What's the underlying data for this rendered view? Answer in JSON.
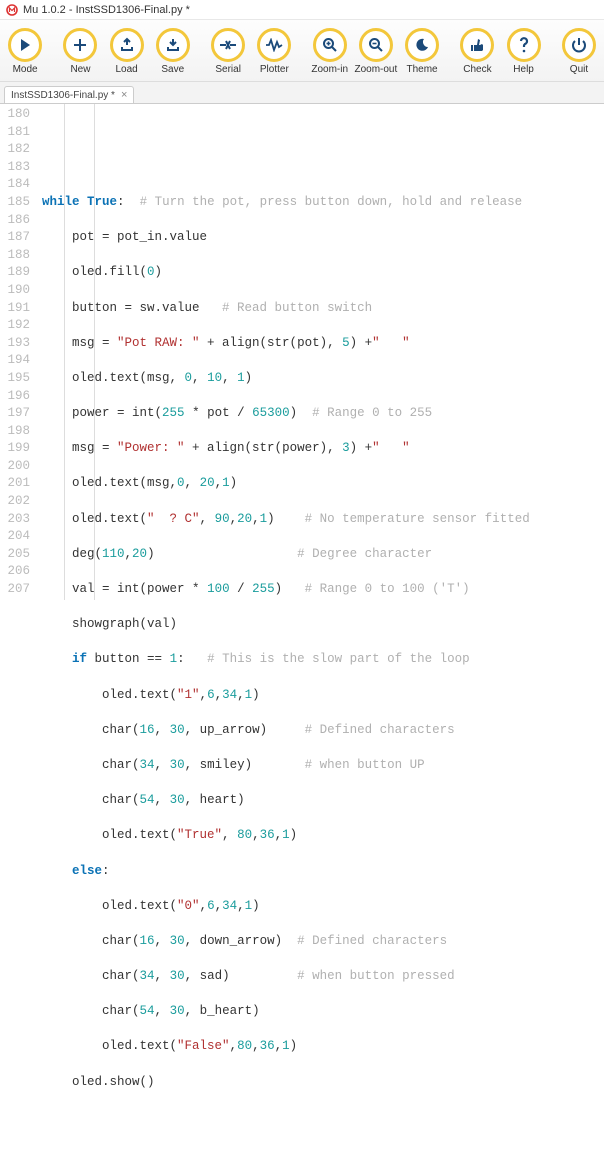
{
  "window": {
    "title": "Mu 1.0.2 - InstSSD1306-Final.py *"
  },
  "toolbar": {
    "mode": "Mode",
    "new": "New",
    "load": "Load",
    "save": "Save",
    "serial": "Serial",
    "plotter": "Plotter",
    "zoom_in": "Zoom-in",
    "zoom_out": "Zoom-out",
    "theme": "Theme",
    "check": "Check",
    "help": "Help",
    "quit": "Quit"
  },
  "tab": {
    "label": "InstSSD1306-Final.py *"
  },
  "line_start": 180,
  "line_end": 207,
  "code": {
    "l180": "",
    "l181_kw": "while",
    "l181_tr": "True",
    "l181_co": ":",
    "l181_cm": "  # Turn the pot, press button down, hold and release",
    "l182_a": "    pot ",
    "l182_op": "=",
    "l182_b": " pot_in.value",
    "l183_a": "    oled.fill(",
    "l183_n": "0",
    "l183_b": ")",
    "l184_a": "    button ",
    "l184_op": "=",
    "l184_b": " sw.value   ",
    "l184_cm": "# Read button switch",
    "l185_a": "    msg ",
    "l185_op": "=",
    "l185_s1": " \"Pot RAW: \"",
    "l185_b": " + align(str(pot), ",
    "l185_n": "5",
    "l185_c": ") +",
    "l185_s2": "\"   \"",
    "l186_a": "    oled.text(msg, ",
    "l186_n1": "0",
    "l186_b": ", ",
    "l186_n2": "10",
    "l186_c": ", ",
    "l186_n3": "1",
    "l186_d": ")",
    "l187_a": "    power ",
    "l187_op": "=",
    "l187_b": " int(",
    "l187_n1": "255",
    "l187_c": " * pot / ",
    "l187_n2": "65300",
    "l187_d": ")  ",
    "l187_cm": "# Range 0 to 255",
    "l188_a": "    msg ",
    "l188_op": "=",
    "l188_s1": " \"Power: \"",
    "l188_b": " + align(str(power), ",
    "l188_n": "3",
    "l188_c": ") +",
    "l188_s2": "\"   \"",
    "l189_a": "    oled.text(msg,",
    "l189_n1": "0",
    "l189_b": ", ",
    "l189_n2": "20",
    "l189_c": ",",
    "l189_n3": "1",
    "l189_d": ")",
    "l190_a": "    oled.text(",
    "l190_s": "\"  ? C\"",
    "l190_b": ", ",
    "l190_n1": "90",
    "l190_c": ",",
    "l190_n2": "20",
    "l190_d": ",",
    "l190_n3": "1",
    "l190_e": ")    ",
    "l190_cm": "# No temperature sensor fitted",
    "l191_a": "    deg(",
    "l191_n1": "110",
    "l191_b": ",",
    "l191_n2": "20",
    "l191_c": ")                   ",
    "l191_cm": "# Degree character",
    "l192_a": "    val ",
    "l192_op": "=",
    "l192_b": " int(power * ",
    "l192_n1": "100",
    "l192_c": " / ",
    "l192_n2": "255",
    "l192_d": ")   ",
    "l192_cm": "# Range 0 to 100 ('T')",
    "l193_a": "    showgraph(val)",
    "l194_in": "    ",
    "l194_kw": "if",
    "l194_a": " button ",
    "l194_op": "==",
    "l194_b": " ",
    "l194_n": "1",
    "l194_c": ":   ",
    "l194_cm": "# This is the slow part of the loop",
    "l195_a": "        oled.text(",
    "l195_s": "\"1\"",
    "l195_b": ",",
    "l195_n1": "6",
    "l195_c": ",",
    "l195_n2": "34",
    "l195_d": ",",
    "l195_n3": "1",
    "l195_e": ")",
    "l196_a": "        char(",
    "l196_n1": "16",
    "l196_b": ", ",
    "l196_n2": "30",
    "l196_c": ", up_arrow)     ",
    "l196_cm": "# Defined characters",
    "l197_a": "        char(",
    "l197_n1": "34",
    "l197_b": ", ",
    "l197_n2": "30",
    "l197_c": ", smiley)       ",
    "l197_cm": "# when button UP",
    "l198_a": "        char(",
    "l198_n1": "54",
    "l198_b": ", ",
    "l198_n2": "30",
    "l198_c": ", heart)",
    "l199_a": "        oled.text(",
    "l199_s": "\"True\"",
    "l199_b": ", ",
    "l199_n1": "80",
    "l199_c": ",",
    "l199_n2": "36",
    "l199_d": ",",
    "l199_n3": "1",
    "l199_e": ")",
    "l200_in": "    ",
    "l200_kw": "else",
    "l200_c": ":",
    "l201_a": "        oled.text(",
    "l201_s": "\"0\"",
    "l201_b": ",",
    "l201_n1": "6",
    "l201_c": ",",
    "l201_n2": "34",
    "l201_d": ",",
    "l201_n3": "1",
    "l201_e": ")",
    "l202_a": "        char(",
    "l202_n1": "16",
    "l202_b": ", ",
    "l202_n2": "30",
    "l202_c": ", down_arrow)  ",
    "l202_cm": "# Defined characters",
    "l203_a": "        char(",
    "l203_n1": "34",
    "l203_b": ", ",
    "l203_n2": "30",
    "l203_c": ", sad)         ",
    "l203_cm": "# when button pressed",
    "l204_a": "        char(",
    "l204_n1": "54",
    "l204_b": ", ",
    "l204_n2": "30",
    "l204_c": ", b_heart)",
    "l205_a": "        oled.text(",
    "l205_s": "\"False\"",
    "l205_b": ",",
    "l205_n1": "80",
    "l205_c": ",",
    "l205_n2": "36",
    "l205_d": ",",
    "l205_n3": "1",
    "l205_e": ")",
    "l206_a": "    oled.show()",
    "l207": ""
  }
}
